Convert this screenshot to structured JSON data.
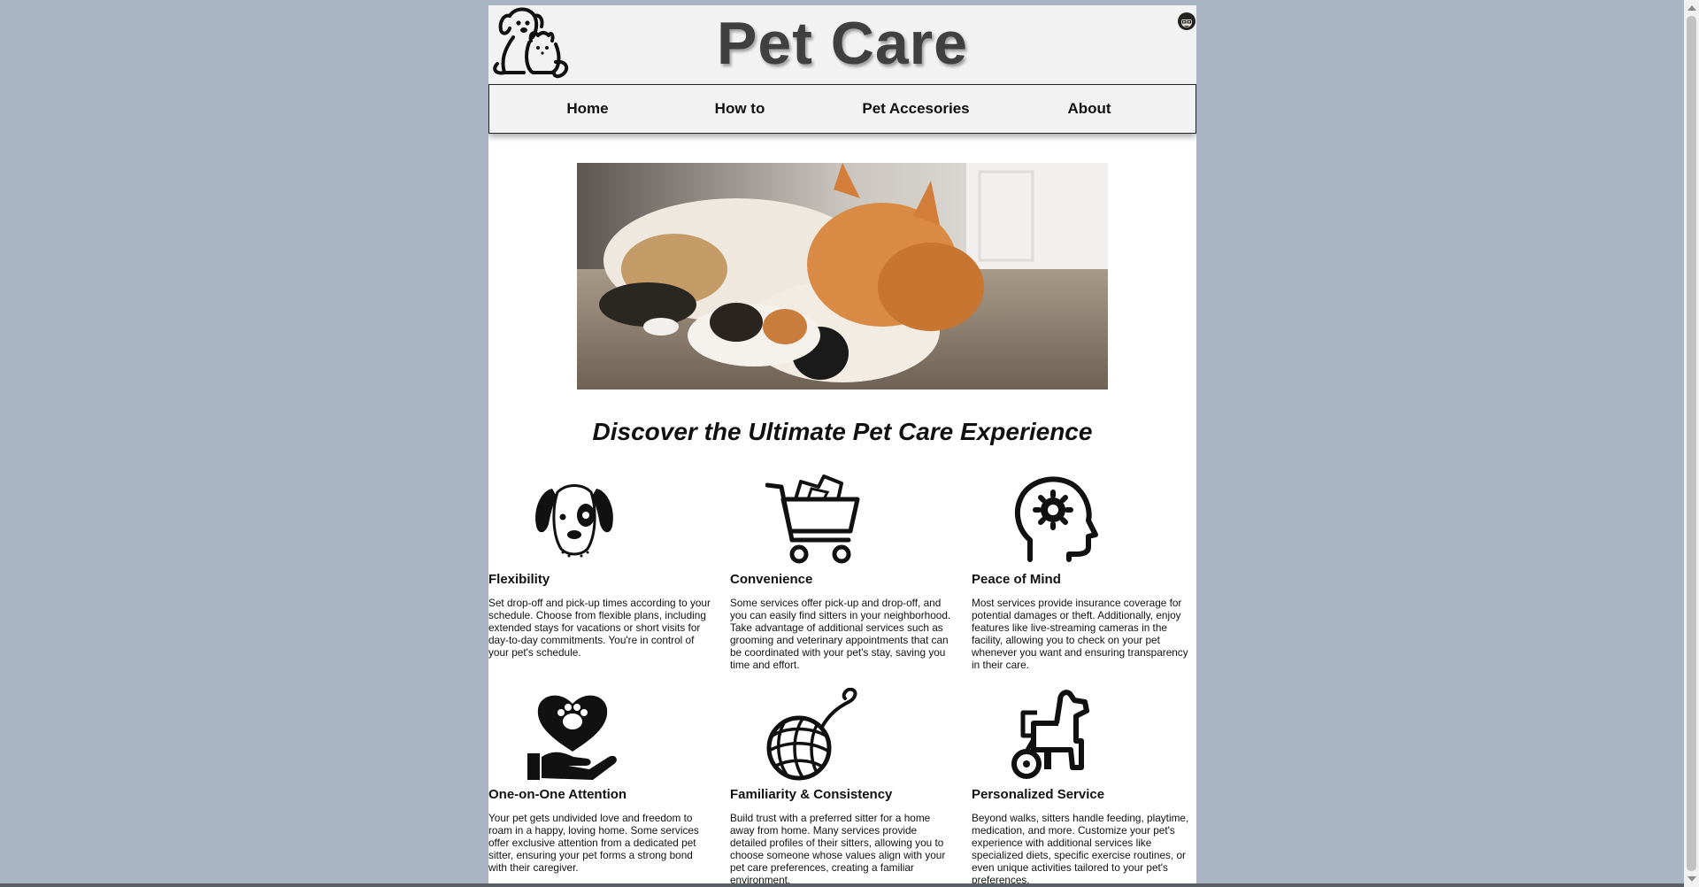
{
  "site": {
    "title": "Pet Care"
  },
  "nav": {
    "items": [
      {
        "label": "Home"
      },
      {
        "label": "How to"
      },
      {
        "label": "Pet Accesories"
      },
      {
        "label": "About"
      }
    ]
  },
  "hero": {
    "alt": "dog and cats sleeping together on carpet"
  },
  "headline": "Discover the Ultimate Pet Care Experience",
  "features": [
    {
      "icon": "dog-face-icon",
      "title": "Flexibility",
      "text": "Set drop-off and pick-up times according to your schedule. Choose from flexible plans, including extended stays for vacations or short visits for day-to-day commitments. You're in control of your pet's schedule."
    },
    {
      "icon": "shopping-cart-icon",
      "title": "Convenience",
      "text": "Some services offer pick-up and drop-off, and you can easily find sitters in your neighborhood. Take advantage of additional services such as grooming and veterinary appointments that can be coordinated with your pet's stay, saving you time and effort."
    },
    {
      "icon": "head-gear-icon",
      "title": "Peace of Mind",
      "text": "Most services provide insurance coverage for potential damages or theft. Additionally, enjoy features like live-streaming cameras in the facility, allowing you to check on your pet whenever you want and ensuring transparency in their care."
    },
    {
      "icon": "heart-hand-icon",
      "title": "One-on-One Attention",
      "text": "Your pet gets undivided love and freedom to roam in a happy, loving home. Some services offer exclusive attention from a dedicated pet sitter, ensuring your pet forms a strong bond with their caregiver."
    },
    {
      "icon": "yarn-ball-icon",
      "title": "Familiarity & Consistency",
      "text": "Build trust with a preferred sitter for a home away from home. Many services provide detailed profiles of their sitters, allowing you to choose someone whose values align with your pet care preferences, creating a familiar environment."
    },
    {
      "icon": "dog-wheelchair-icon",
      "title": "Personalized Service",
      "text": "Beyond walks, sitters handle feeding, playtime, medication, and more. Customize your pet's experience with additional services like specialized diets, specific exercise routines, or even unique activities tailored to your pet's preferences."
    }
  ]
}
